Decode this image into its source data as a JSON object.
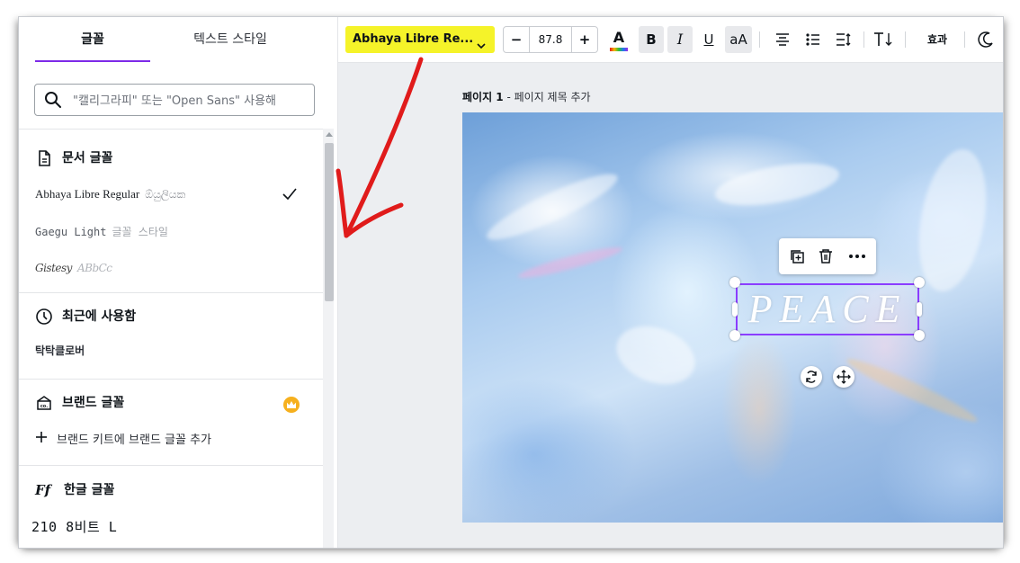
{
  "panel": {
    "tabs": {
      "fonts": "글꼴",
      "text_styles": "텍스트 스타일"
    },
    "search": {
      "placeholder": "\"캘리그라피\" 또는 \"Open Sans\" 사용해 "
    },
    "sections": {
      "document_fonts": {
        "title": "문서 글꼴",
        "items": [
          {
            "name": "Abhaya Libre Regular",
            "sample": "ඕයුලියක",
            "selected": true
          },
          {
            "name": "Gaegu Light",
            "sample": "글꼴 스타일"
          },
          {
            "name": "Gistesy",
            "sample": "ABbCc"
          }
        ]
      },
      "recent": {
        "title": "최근에 사용함",
        "items": [
          {
            "name": "탁탁클로버"
          }
        ]
      },
      "brand": {
        "title": "브랜드 글꼴",
        "add_label": "브랜드 키트에 브랜드 글꼴 추가"
      },
      "hangul": {
        "title": "한글 글꼴",
        "items": [
          {
            "name": "210 8비트 L"
          }
        ]
      }
    }
  },
  "toolbar": {
    "font_family": "Abhaya Libre Re...",
    "font_size": "87.8",
    "minus": "−",
    "plus": "+",
    "color_letter": "A",
    "bold": "B",
    "italic": "I",
    "underline": "U",
    "case": "aA",
    "effects": "효과",
    "highlight_color": "#f5f329"
  },
  "page": {
    "label_bold": "페이지 1",
    "label_rest": " - 페이지 제목 추가"
  },
  "canvas": {
    "text": "PEACE",
    "selection_color": "#8b3dff"
  },
  "annotation": {
    "arrow_color": "#e01b1b"
  }
}
